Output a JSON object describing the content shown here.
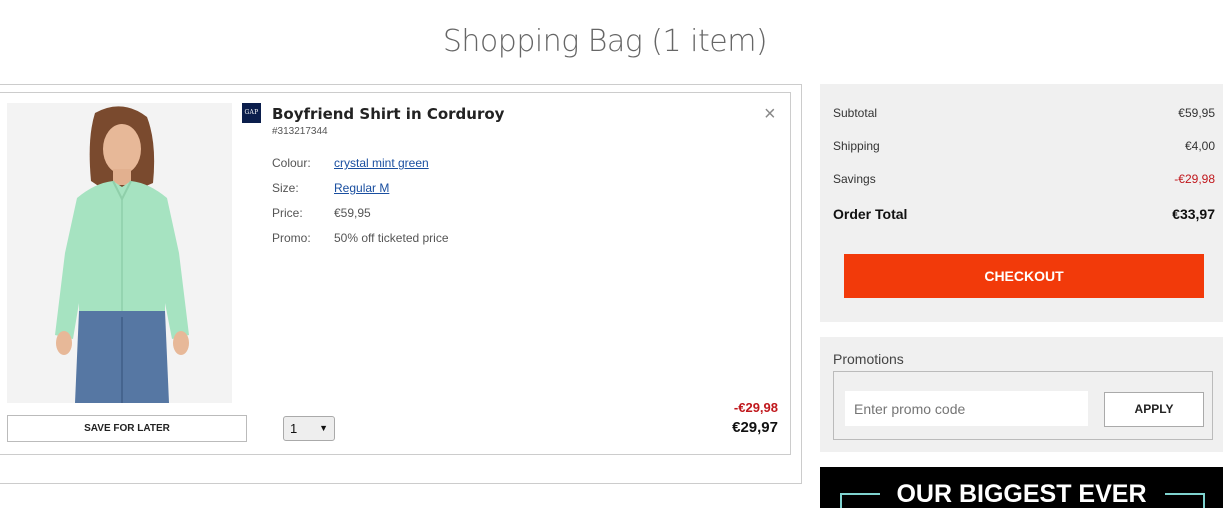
{
  "page": {
    "title": "Shopping Bag (1 item)"
  },
  "item": {
    "brand_logo": "GAP",
    "name": "Boyfriend Shirt in Corduroy",
    "sku": "#313217344",
    "attributes": [
      {
        "label": "Colour:",
        "value": "crystal mint green",
        "link": true
      },
      {
        "label": "Size:",
        "value": "Regular M",
        "link": true
      },
      {
        "label": "Price:",
        "value": "€59,95",
        "link": false
      },
      {
        "label": "Promo:",
        "value": "50% off ticketed price",
        "link": false
      }
    ],
    "save_later_label": "SAVE FOR LATER",
    "quantity": "1",
    "saving": "-€29,98",
    "final_price": "€29,97",
    "remove_icon": "close-icon"
  },
  "summary": {
    "subtotal_label": "Subtotal",
    "subtotal_value": "€59,95",
    "shipping_label": "Shipping",
    "shipping_value": "€4,00",
    "savings_label": "Savings",
    "savings_value": "-€29,98",
    "total_label": "Order Total",
    "total_value": "€33,97",
    "checkout_label": "CHECKOUT"
  },
  "promotions": {
    "title": "Promotions",
    "placeholder": "Enter promo code",
    "apply_label": "APPLY"
  },
  "banner": {
    "text": "OUR BIGGEST EVER"
  },
  "colors": {
    "checkout": "#f23a0a",
    "saving_red": "#c0171c",
    "link_blue": "#1a4fa0",
    "brand_navy": "#0b1e4c"
  }
}
